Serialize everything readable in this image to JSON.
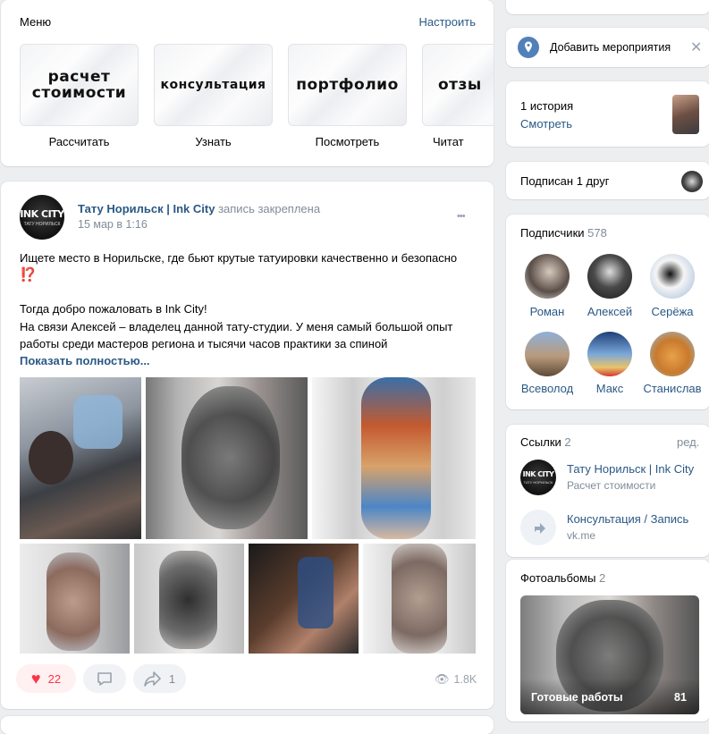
{
  "menu": {
    "title": "Меню",
    "configure": "Настроить",
    "tiles": [
      {
        "title": "расчет стоимости",
        "caption": "Рассчитать"
      },
      {
        "title": "консультация",
        "caption": "Узнать"
      },
      {
        "title": "портфолио",
        "caption": "Посмотреть"
      },
      {
        "title": "отзы",
        "caption": "Читат"
      }
    ]
  },
  "post": {
    "avatar_text": "INK CITY",
    "avatar_sub": "ТАТУ НОРИЛЬСК",
    "author": "Тату Норильск | Ink City",
    "pinned": "запись закреплена",
    "date": "15 мар в 1:16",
    "more": "•••",
    "text_line1": "Ищете место в Норильске, где бьют крутые татуировки качественно и безопасно",
    "emoji": "⁉️",
    "text_line2": "Тогда добро пожаловать в Ink City!",
    "text_line3": "На связи Алексей – владелец данной тату-студии. У меня самый большой опыт",
    "text_line4": "работы среди мастеров региона и тысячи часов практики за спиной",
    "show_more": "Показать полностью...",
    "likes": "22",
    "reposts": "1",
    "views": "1.8K"
  },
  "sidebar": {
    "event_label": "Добавить мероприятия",
    "stories_count": "1 история",
    "stories_watch": "Смотреть",
    "friend_sub": "Подписан 1 друг",
    "subscribers_title": "Подписчики",
    "subscribers_count": "578",
    "subscribers": [
      "Роман",
      "Алексей",
      "Серёжа",
      "Всеволод",
      "Макс",
      "Станислав"
    ],
    "links_title": "Ссылки",
    "links_count": "2",
    "links_edit": "ред.",
    "links": [
      {
        "title": "Тату Норильск | Ink City",
        "sub": "Расчет стоимости"
      },
      {
        "title": "Консультация / Запись",
        "sub": "vk.me"
      }
    ],
    "albums_title": "Фотоальбомы",
    "albums_count": "2",
    "album_name": "Готовые работы",
    "album_count": "81"
  },
  "colors": {
    "accent": "#2a5885",
    "like": "#ff3347",
    "muted": "#818c99"
  }
}
